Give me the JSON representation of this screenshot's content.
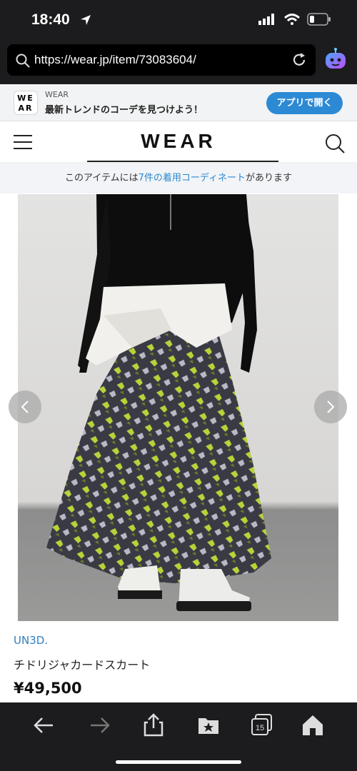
{
  "status_bar": {
    "time": "18:40"
  },
  "browser": {
    "url": "https://wear.jp/item/73083604/"
  },
  "app_banner": {
    "logo_top": "WE",
    "logo_bottom": "AR",
    "name": "WEAR",
    "tagline": "最新トレンドのコーデを見つけよう！",
    "open_button": "アプリで開く"
  },
  "header": {
    "logo": "WEAR"
  },
  "coord_notice": {
    "prefix": "このアイテムには",
    "link": "7件の着用コーディネート",
    "suffix": "があります"
  },
  "product": {
    "brand": "UN3D.",
    "title": "チドリジャカードスカート",
    "price": "¥49,500"
  },
  "toolbar": {
    "items": [
      "back-icon",
      "forward-icon",
      "share-icon",
      "bookmarks-icon",
      "tabs-icon",
      "home-icon"
    ],
    "tab_count": "15"
  },
  "colors": {
    "accent": "#2c8ad5",
    "brand_link": "#2f7fc3",
    "chrome": "#1c1c1e"
  }
}
